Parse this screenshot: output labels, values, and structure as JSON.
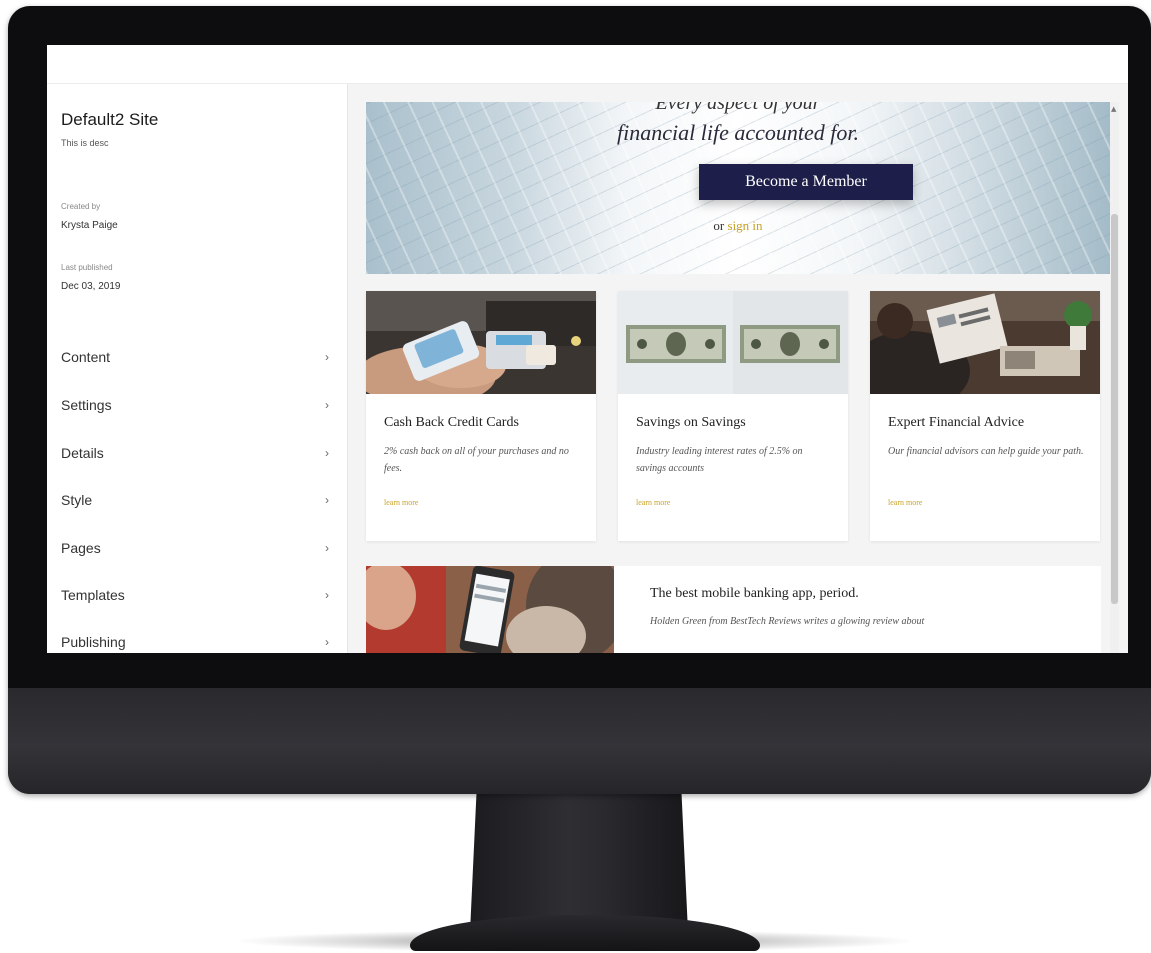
{
  "sidebar": {
    "site_title": "Default2 Site",
    "site_description": "This is desc",
    "created_by_label": "Created by",
    "created_by": "Krysta Paige",
    "last_published_label": "Last published",
    "last_published": "Dec 03, 2019",
    "items": [
      {
        "label": "Content",
        "icon": "chevron-right-icon"
      },
      {
        "label": "Settings",
        "icon": "chevron-right-icon"
      },
      {
        "label": "Details",
        "icon": "chevron-right-icon"
      },
      {
        "label": "Style",
        "icon": "chevron-right-icon"
      },
      {
        "label": "Pages",
        "icon": "chevron-right-icon"
      },
      {
        "label": "Templates",
        "icon": "chevron-right-icon"
      },
      {
        "label": "Publishing",
        "icon": "chevron-right-icon"
      }
    ],
    "chevron": "›"
  },
  "hero": {
    "heading_cut": "Every aspect of your",
    "heading": "financial life accounted for.",
    "button": "Become a Member",
    "or_text": "or",
    "signin_link": "sign in"
  },
  "cards": [
    {
      "title": "Cash Back Credit Cards",
      "text": "2% cash back on all of your purchases and no fees.",
      "link": "learn more",
      "image": "credit-card-payment-photo"
    },
    {
      "title": "Savings on Savings",
      "text": "Industry leading interest rates of 2.5% on savings accounts",
      "link": "learn more",
      "image": "dollar-bills-photo"
    },
    {
      "title": "Expert Financial Advice",
      "text": "Our financial advisors can help guide your path.",
      "link": "learn more",
      "image": "business-newspaper-photo"
    }
  ],
  "promo": {
    "title": "The best mobile banking app, period.",
    "text": "Holden Green from BestTech Reviews writes a glowing review about",
    "image": "mobile-phone-photo"
  },
  "colors": {
    "accent_gold": "#c9a227",
    "button_navy": "#1d1f4a",
    "monitor_bezel": "#0d0d0f"
  },
  "scrollbar": {
    "up_arrow": "▲"
  }
}
